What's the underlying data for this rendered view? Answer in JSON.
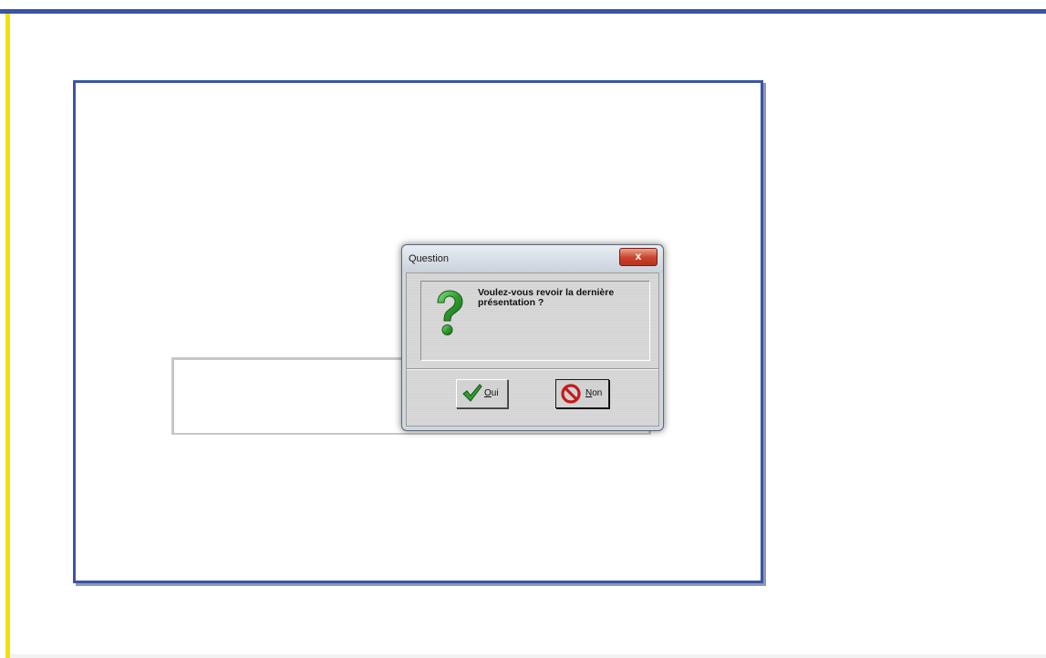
{
  "dialog": {
    "title": "Question",
    "close_symbol": "x",
    "message_line1": "Voulez-vous revoir la dernière",
    "message_line2": "présentation ?",
    "icon": "question-mark-icon",
    "buttons": {
      "yes_accel": "O",
      "yes_rest": "ui",
      "yes_icon": "checkmark-icon",
      "no_accel": "N",
      "no_rest": "on",
      "no_icon": "no-sign-icon"
    }
  },
  "colors": {
    "frame_border": "#3a55a3",
    "left_accent": "#f2e200",
    "dialog_bg": "#d2d2d2",
    "close_button": "#c7432b"
  }
}
